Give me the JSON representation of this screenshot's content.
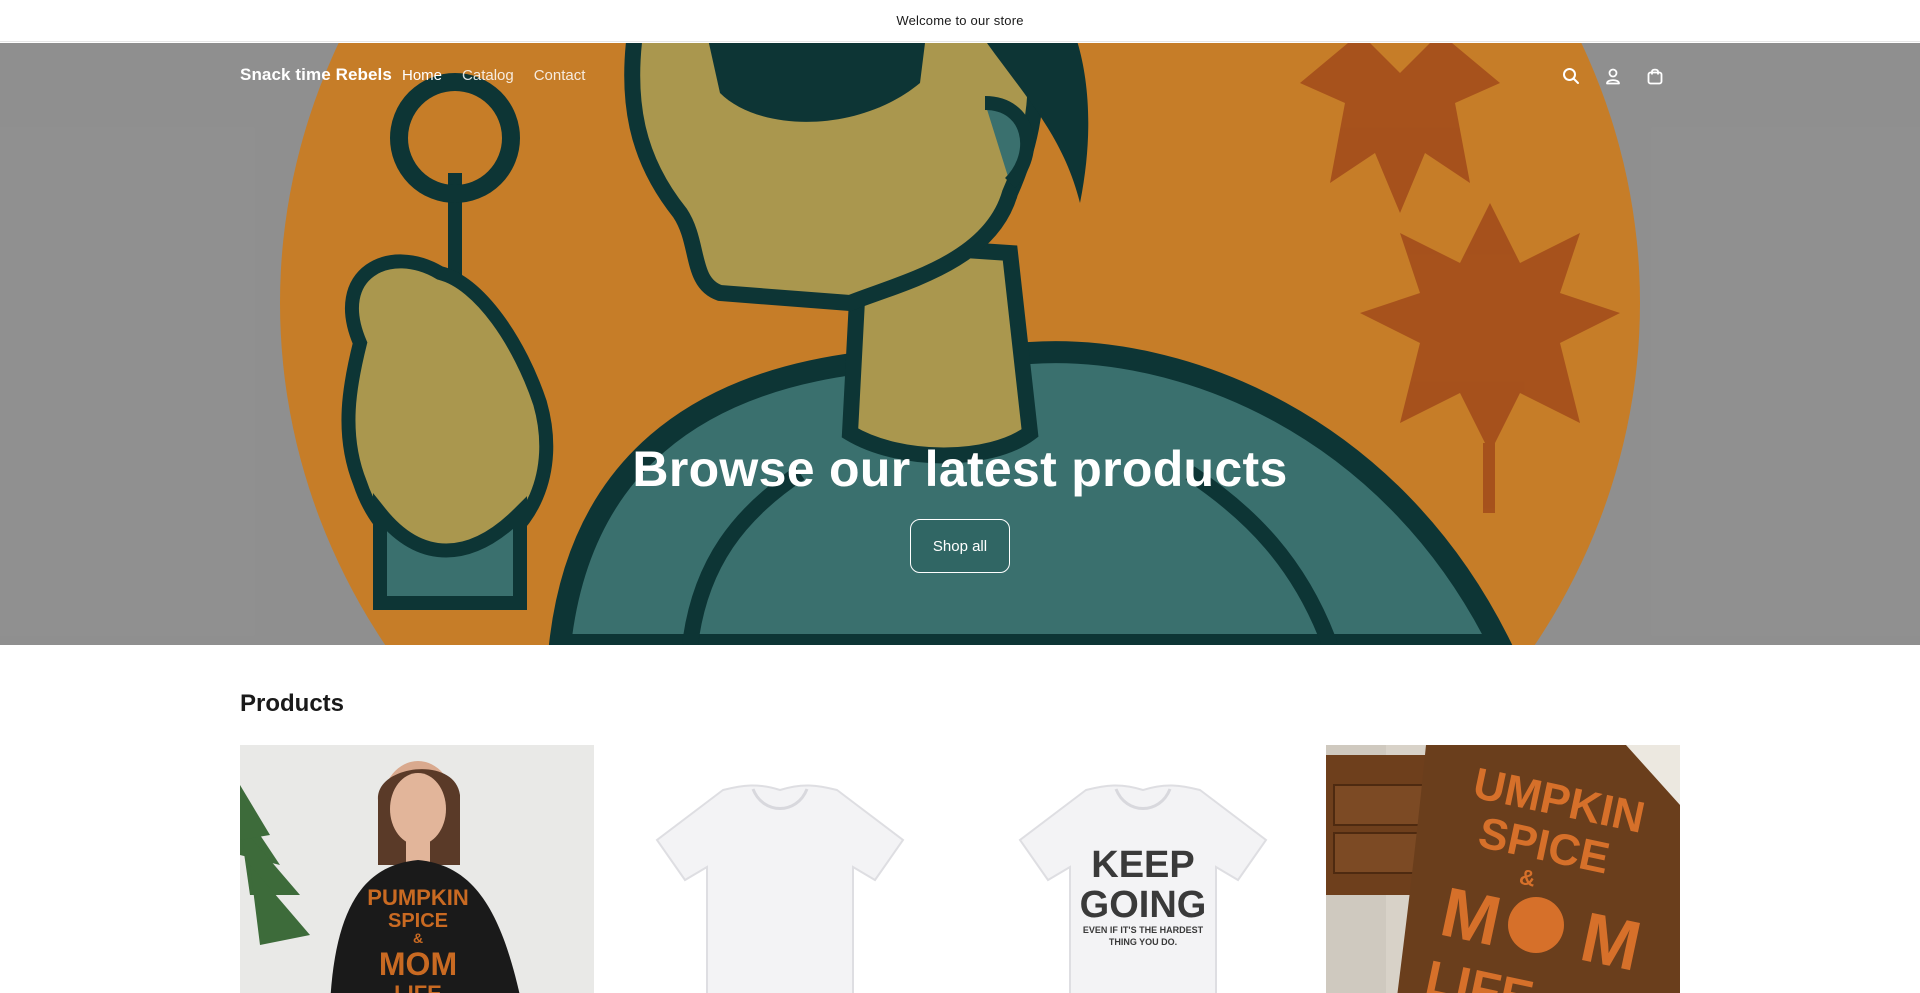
{
  "announcement": {
    "text": "Welcome to our store"
  },
  "header": {
    "brand": "Snack time Rebels",
    "nav": [
      {
        "label": "Home",
        "active": true
      },
      {
        "label": "Catalog",
        "active": false
      },
      {
        "label": "Contact",
        "active": false
      }
    ],
    "icons": [
      "search-icon",
      "account-icon",
      "cart-icon"
    ]
  },
  "hero": {
    "heading": "Browse our latest products",
    "button_label": "Shop all"
  },
  "products": {
    "title": "Products",
    "items": [
      {
        "image": "pumpkin-spice-mom-life-sweatshirt",
        "print": [
          "PUMPKIN",
          "SPICE",
          "&",
          "MOM",
          "LIFE"
        ]
      },
      {
        "image": "plain-white-t-shirt"
      },
      {
        "image": "keep-going-t-shirt",
        "print": [
          "KEEP",
          "GOING",
          "EVEN IF IT'S THE HARDEST",
          "THING YOU DO."
        ]
      },
      {
        "image": "pumpkin-spice-mom-life-blanket",
        "print": [
          "UMPKIN",
          "SPICE",
          "&",
          "M",
          "M",
          "LIFE"
        ]
      }
    ]
  },
  "colors": {
    "hero_orange": "#d7882c",
    "hero_teal": "#3f7a78",
    "hero_dark": "#0f3a3a",
    "skin": "#b9a455",
    "leaf": "#b4561f",
    "overlay_gray": "#9c9c9c"
  }
}
